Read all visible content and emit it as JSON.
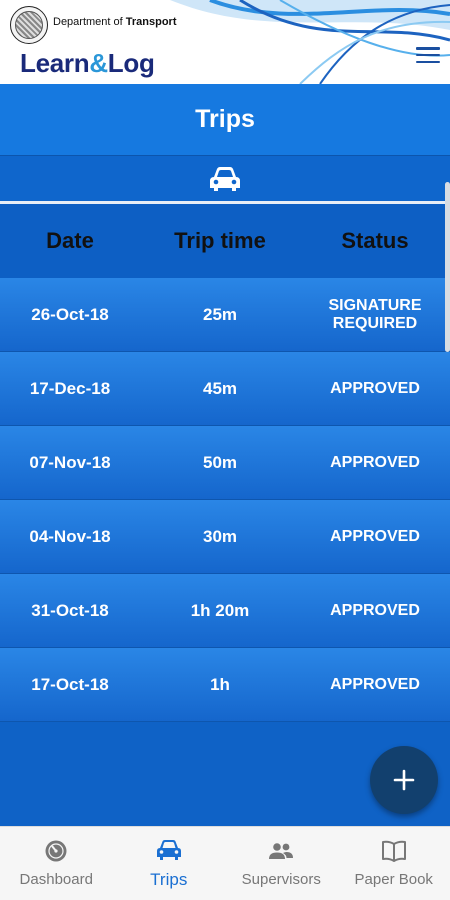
{
  "header": {
    "dept_prefix": "Department of ",
    "dept_name": "Transport",
    "brand_left": "Learn",
    "brand_amp": "&",
    "brand_right": "Log"
  },
  "page": {
    "title": "Trips"
  },
  "table": {
    "columns": [
      "Date",
      "Trip time",
      "Status"
    ],
    "rows": [
      {
        "date": "26-Oct-18",
        "time": "25m",
        "status_line1": "SIGNATURE",
        "status_line2": "REQUIRED"
      },
      {
        "date": "17-Dec-18",
        "time": "45m",
        "status_line1": "APPROVED",
        "status_line2": ""
      },
      {
        "date": "07-Nov-18",
        "time": "50m",
        "status_line1": "APPROVED",
        "status_line2": ""
      },
      {
        "date": "04-Nov-18",
        "time": "30m",
        "status_line1": "APPROVED",
        "status_line2": ""
      },
      {
        "date": "31-Oct-18",
        "time": "1h 20m",
        "status_line1": "APPROVED",
        "status_line2": ""
      },
      {
        "date": "17-Oct-18",
        "time": "1h",
        "status_line1": "APPROVED",
        "status_line2": ""
      }
    ]
  },
  "fab": {
    "icon": "plus-icon"
  },
  "nav": {
    "items": [
      {
        "label": "Dashboard",
        "icon": "dashboard-icon"
      },
      {
        "label": "Trips",
        "icon": "car-icon"
      },
      {
        "label": "Supervisors",
        "icon": "people-icon"
      },
      {
        "label": "Paper Book",
        "icon": "book-icon"
      }
    ],
    "active_color": "#1a6fd2"
  },
  "colors": {
    "brand": "#1a2a7a",
    "accent": "#2b97d8",
    "table_blue": "#1679e0",
    "fab": "#12406e"
  }
}
